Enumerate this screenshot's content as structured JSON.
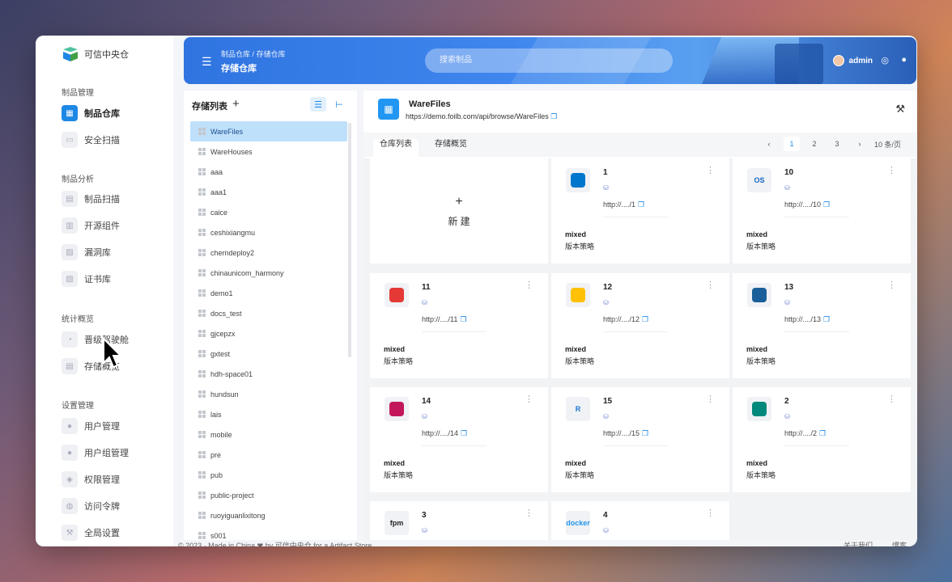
{
  "brand": {
    "name": "可信中央仓"
  },
  "sidebar": {
    "sections": [
      {
        "title": "制品管理",
        "items": [
          {
            "label": "制品仓库",
            "active": true
          },
          {
            "label": "安全扫描"
          }
        ]
      },
      {
        "title": "制品分析",
        "items": [
          {
            "label": "制品扫描"
          },
          {
            "label": "开源组件"
          },
          {
            "label": "漏洞库"
          },
          {
            "label": "证书库"
          }
        ]
      },
      {
        "title": "统计概览",
        "items": [
          {
            "label": "晋级驾驶舱"
          },
          {
            "label": "存储概览"
          }
        ]
      },
      {
        "title": "设置管理",
        "items": [
          {
            "label": "用户管理"
          },
          {
            "label": "用户组管理"
          },
          {
            "label": "权限管理"
          },
          {
            "label": "访问令牌"
          },
          {
            "label": "全局设置"
          }
        ]
      }
    ]
  },
  "header": {
    "breadcrumb": "制品仓库 / 存储仓库",
    "title": "存储仓库",
    "search_placeholder": "搜索制品",
    "user": "admin"
  },
  "repo_panel": {
    "title": "存储列表",
    "items": [
      "WareFiles",
      "WareHouses",
      "aaa",
      "aaa1",
      "caice",
      "ceshixiangmu",
      "cherndeploy2",
      "chinaunicom_harmony",
      "demo1",
      "docs_test",
      "gjcepzx",
      "gxtest",
      "hdh-space01",
      "hundsun",
      "lais",
      "mobile",
      "pre",
      "pub",
      "public-project",
      "ruoyiguanlixitong",
      "s001"
    ],
    "selected_index": 0
  },
  "detail": {
    "title": "WareFiles",
    "url": "https://demo.foilb.com/api/browse/WareFiles",
    "tabs": [
      "仓库列表",
      "存储概览"
    ],
    "active_tab": 0,
    "pager": {
      "pages": [
        "1",
        "2",
        "3"
      ],
      "current": "1",
      "page_size": "10 条/页"
    },
    "new_label": "新 建",
    "cards": [
      {
        "name": "1",
        "url": "http://..../1",
        "type": "mixed",
        "policy": "版本策略",
        "icon": "elastic",
        "icon_color": "#0077cc"
      },
      {
        "name": "10",
        "url": "http://..../10",
        "type": "mixed",
        "policy": "版本策略",
        "icon": "openos",
        "icon_color": "#1565c0",
        "icon_text": "OS"
      },
      {
        "name": "11",
        "url": "http://..../11",
        "type": "mixed",
        "policy": "版本策略",
        "icon": "ruby-gems",
        "icon_color": "#e53935"
      },
      {
        "name": "12",
        "url": "http://..../12",
        "type": "mixed",
        "policy": "版本策略",
        "icon": "huggingface",
        "icon_color": "#ffc107"
      },
      {
        "name": "13",
        "url": "http://..../13",
        "type": "mixed",
        "policy": "版本策略",
        "icon": "sbt",
        "icon_color": "#1a5f99"
      },
      {
        "name": "14",
        "url": "http://..../14",
        "type": "mixed",
        "policy": "版本策略",
        "icon": "debian",
        "icon_color": "#c2185b"
      },
      {
        "name": "15",
        "url": "http://..../15",
        "type": "mixed",
        "policy": "版本策略",
        "icon": "rust-r",
        "icon_color": "#1976d2",
        "icon_text": "R"
      },
      {
        "name": "2",
        "url": "http://..../2",
        "type": "mixed",
        "policy": "版本策略",
        "icon": "dolphin",
        "icon_color": "#00897b"
      },
      {
        "name": "3",
        "url": "",
        "type": "",
        "policy": "",
        "icon": "fpm",
        "icon_color": "#222222",
        "icon_text": "fpm"
      },
      {
        "name": "4",
        "url": "",
        "type": "",
        "policy": "",
        "icon": "docker",
        "icon_color": "#2496ed",
        "icon_text": "docker"
      }
    ]
  },
  "footer": {
    "text": "© 2023 · Made in China ❤ by 可信中央仓 for a Artifact Store",
    "about": "关于我们",
    "right": "爆客"
  }
}
